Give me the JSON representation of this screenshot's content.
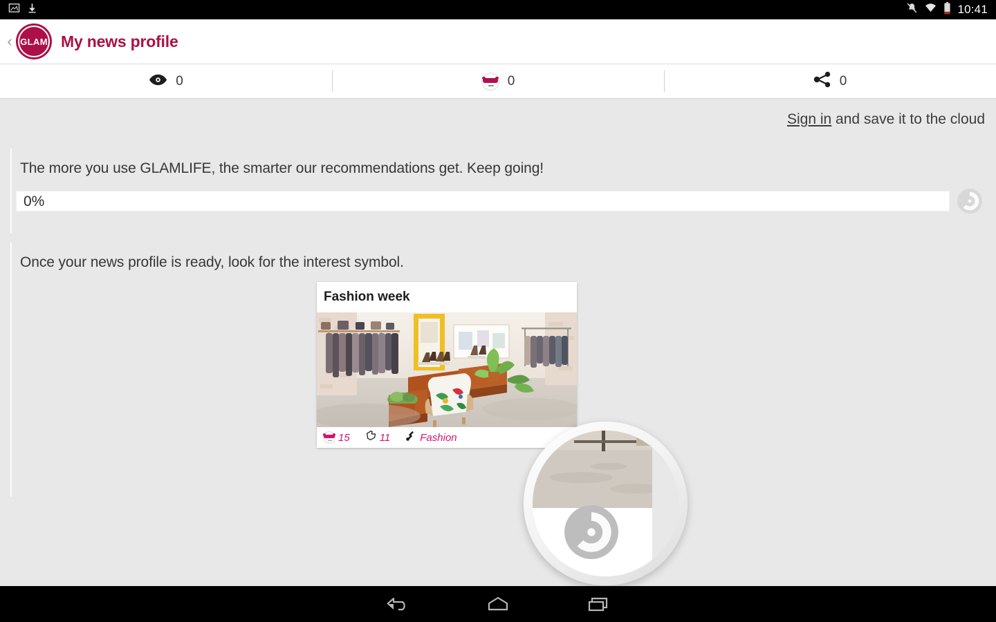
{
  "status_bar": {
    "time": "10:41",
    "left_icons": [
      "screenshot-image-icon",
      "download-icon"
    ],
    "right_icons": [
      "vibrate-off-icon",
      "wifi-icon",
      "battery-icon"
    ]
  },
  "app_bar": {
    "back_label": "‹",
    "logo_text": "GLAM",
    "title": "My news profile",
    "brand_color": "#ad0f46"
  },
  "stats": [
    {
      "icon": "eye-icon",
      "value": "0"
    },
    {
      "icon": "cool-face-icon",
      "value": "0"
    },
    {
      "icon": "share-icon",
      "value": "0"
    }
  ],
  "signin": {
    "link_label": "Sign in",
    "rest_label": " and save it to the cloud"
  },
  "section_progress": {
    "text": "The more you use GLAMLIFE, the smarter our recommendations get. Keep going!",
    "percent_label": "0%",
    "percent_value": 0,
    "symbol": "interest-symbol-icon"
  },
  "section_hint": {
    "text": "Once your news profile is ready, look for the interest symbol."
  },
  "card": {
    "title": "Fashion week",
    "photo_alt": "boutique-store-interior-photo",
    "reactions_icon": "cool-face-icon",
    "reactions": "15",
    "claps_icon": "clap-hand-icon",
    "claps": "11",
    "tag_icon": "tag-icon",
    "tag": "Fashion"
  },
  "magnifier": {
    "label": "interest-symbol-magnifier",
    "symbol": "interest-symbol-icon"
  },
  "nav_bar": {
    "buttons": [
      "back-nav-icon",
      "home-nav-icon",
      "recents-nav-icon"
    ]
  }
}
